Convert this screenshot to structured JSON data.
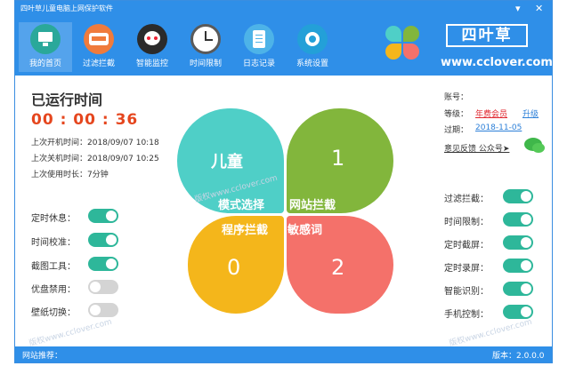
{
  "window": {
    "title": "四叶草儿童电脑上网保护软件"
  },
  "nav": [
    {
      "label": "我的首页",
      "icon": "monitor-icon"
    },
    {
      "label": "过滤拦截",
      "icon": "shield-icon"
    },
    {
      "label": "智能监控",
      "icon": "cat-icon"
    },
    {
      "label": "时间限制",
      "icon": "clock-icon"
    },
    {
      "label": "日志记录",
      "icon": "clipboard-icon"
    },
    {
      "label": "系统设置",
      "icon": "gear-icon"
    }
  ],
  "logo": {
    "brand": "四叶草",
    "site": "www.cclover.com"
  },
  "runtime": {
    "title": "已运行时间",
    "timer": "00 : 00 : 36",
    "last_on": "上次开机时间：2018/09/07 10:18",
    "last_off": "上次关机时间：2018/09/07 10:25",
    "last_duration": "上次使用时长：7分钟"
  },
  "left_options": [
    {
      "label": "定时休息：",
      "state": "on"
    },
    {
      "label": "时间校准：",
      "state": "on"
    },
    {
      "label": "截图工具：",
      "state": "on"
    },
    {
      "label": "优盘禁用：",
      "state": "off"
    },
    {
      "label": "壁纸切换：",
      "state": "off"
    }
  ],
  "clover": {
    "top_left": {
      "text": "儿童",
      "color": "#4fcfc7"
    },
    "top_right": {
      "text": "1",
      "color": "#82b63c"
    },
    "bottom_left": {
      "text": "0",
      "color": "#f4b61b"
    },
    "bottom_right": {
      "text": "2",
      "color": "#f4716a"
    },
    "labels": {
      "mode": "模式选择",
      "web": "网站拦截",
      "program": "程序拦截",
      "sensitive": "敏感词"
    }
  },
  "account": {
    "account_label": "账号：",
    "level_label": "等级：",
    "level_value": "年费会员",
    "upgrade": "升级",
    "expire_label": "过期：",
    "expire_value": "2018-11-05",
    "feedback": "意见反馈  公众号➤"
  },
  "right_options": [
    {
      "label": "过滤拦截：",
      "state": "on"
    },
    {
      "label": "时间限制：",
      "state": "on"
    },
    {
      "label": "定时截屏：",
      "state": "on"
    },
    {
      "label": "定时录屏：",
      "state": "on"
    },
    {
      "label": "智能识别：",
      "state": "on"
    },
    {
      "label": "手机控制：",
      "state": "on"
    }
  ],
  "footer": {
    "recommend": "网站推荐：",
    "version": "版本：2.0.0.0"
  },
  "watermark": "版权www.cclover.com"
}
